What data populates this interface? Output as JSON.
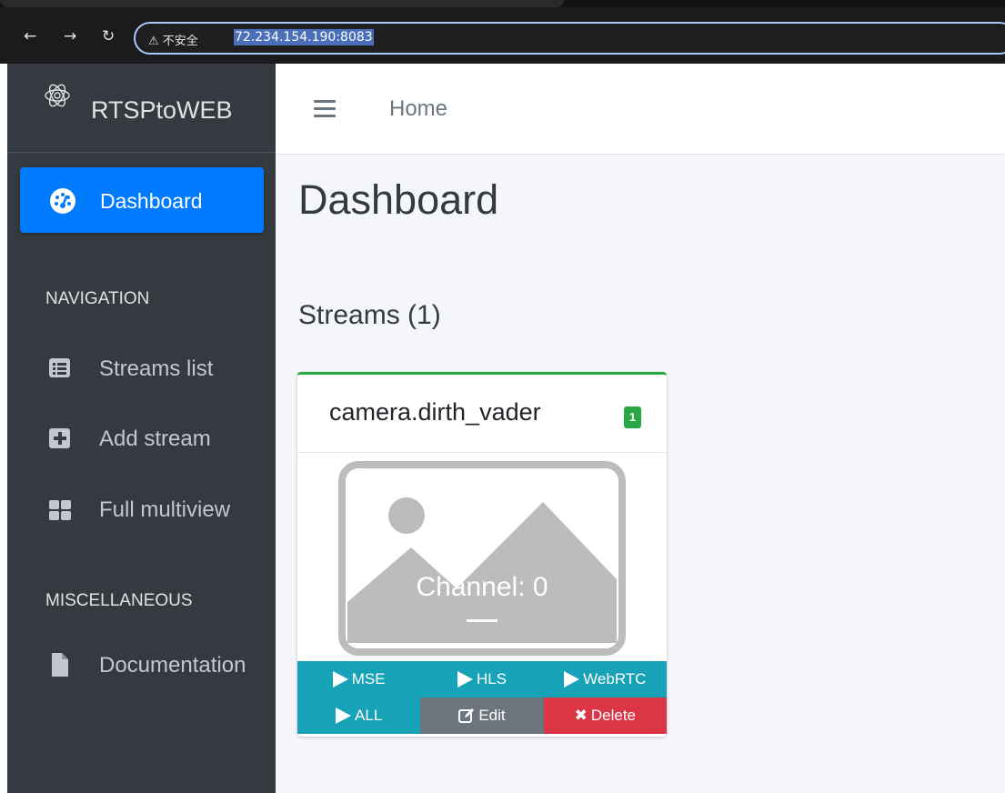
{
  "browser": {
    "back_icon": "back-arrow-icon",
    "forward_icon": "forward-arrow-icon",
    "reload_icon": "reload-icon",
    "security_text": "⚠ 不安全",
    "url": "72.234.154.190:8083"
  },
  "sidebar": {
    "brand": "RTSPtoWEB",
    "active_item": {
      "label": "Dashboard",
      "icon": "tachometer-icon"
    },
    "sections": [
      {
        "header": "NAVIGATION",
        "items": [
          {
            "label": "Streams list",
            "icon": "list-alt-icon"
          },
          {
            "label": "Add stream",
            "icon": "plus-square-icon"
          },
          {
            "label": "Full multiview",
            "icon": "th-large-icon"
          }
        ]
      },
      {
        "header": "MISCELLANEOUS",
        "items": [
          {
            "label": "Documentation",
            "icon": "file-icon"
          }
        ]
      }
    ]
  },
  "topnav": {
    "home_label": "Home"
  },
  "main": {
    "title": "Dashboard",
    "streams_heading": "Streams (1)",
    "stream_card": {
      "name": "camera.dirth_vader",
      "badge": "1",
      "channel_label": "Channel: 0",
      "buttons": {
        "mse": "MSE",
        "hls": "HLS",
        "webrtc": "WebRTC",
        "all": "ALL",
        "edit": "Edit",
        "delete": "Delete"
      }
    }
  },
  "colors": {
    "sidebar_bg": "#343a40",
    "active_blue": "#007bff",
    "card_accent": "#28a745",
    "info": "#17a2b8",
    "secondary": "#6c757d",
    "danger": "#dc3545"
  }
}
